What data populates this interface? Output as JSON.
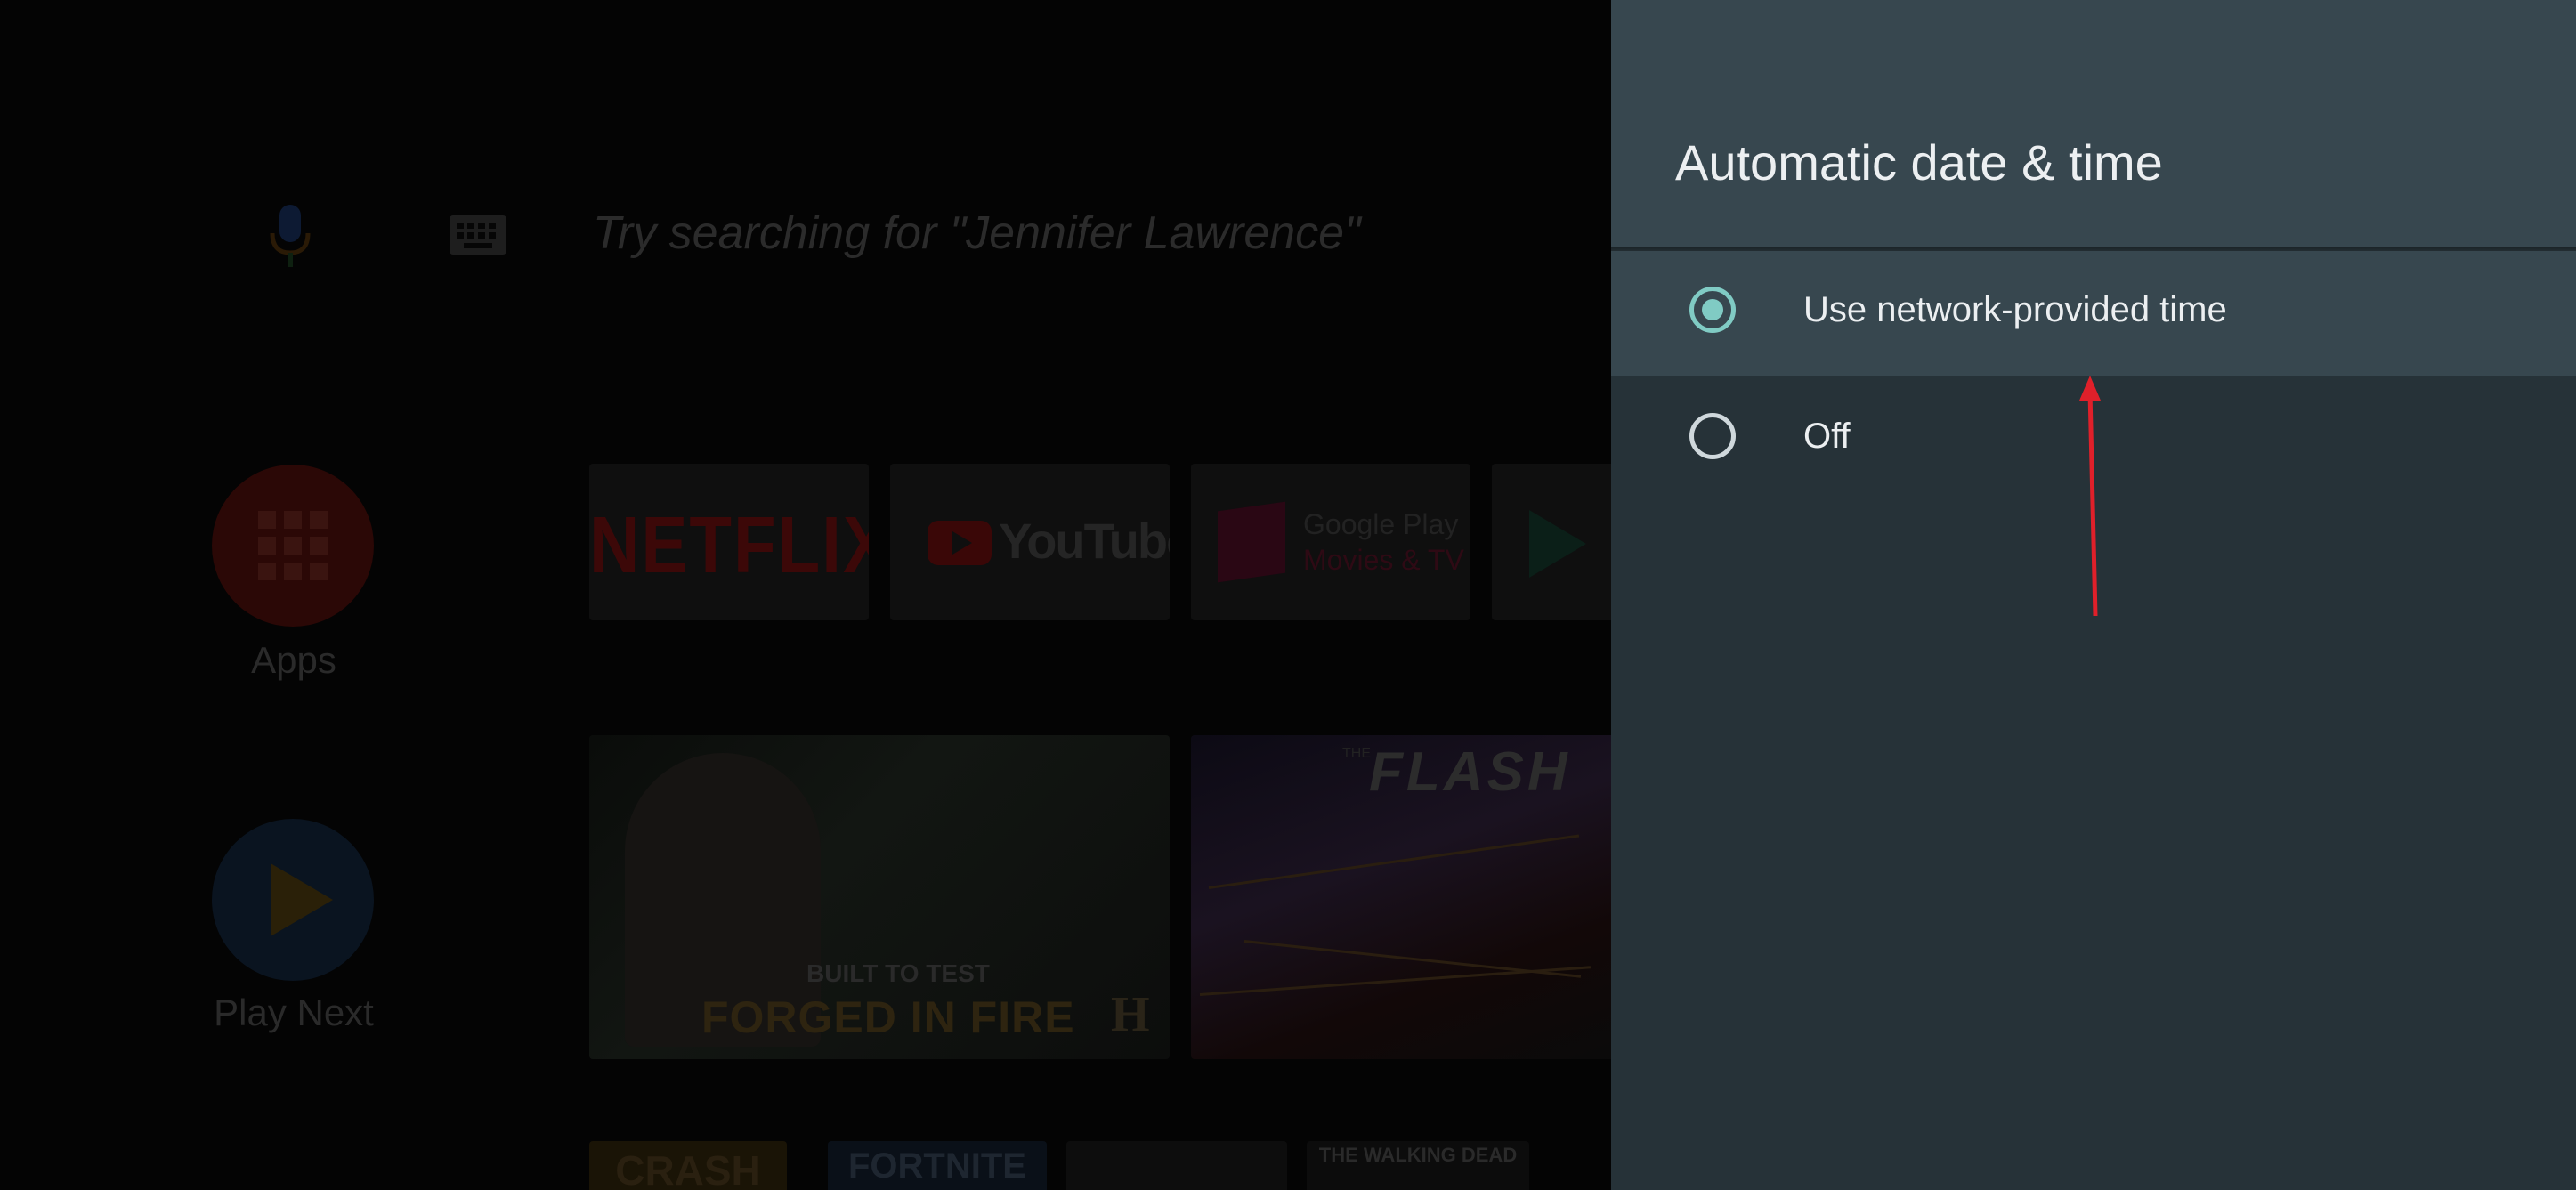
{
  "search": {
    "hint": "Try searching for \"Jennifer Lawrence\""
  },
  "sidebar": {
    "apps_label": "Apps",
    "play_next_label": "Play Next"
  },
  "app_tiles": {
    "netflix": "NETFLIX",
    "youtube": "YouTube",
    "google_play_line1": "Google Play",
    "google_play_line2": "Movies & TV"
  },
  "content_cards": {
    "forged_subtitle": "BUILT TO TEST",
    "forged_title": "FORGED IN FIRE",
    "forged_network": "H",
    "flash_the": "THE",
    "flash_title": "FLASH"
  },
  "bottom_row": {
    "crash": "CRASH",
    "fortnite": "FORTNITE",
    "walking_dead": "THE WALKING DEAD"
  },
  "panel": {
    "title": "Automatic date & time",
    "options": [
      {
        "label": "Use network-provided time",
        "selected": true
      },
      {
        "label": "Off",
        "selected": false
      }
    ]
  },
  "colors": {
    "panel_bg": "#263238",
    "panel_header_bg": "#37474f",
    "radio_accent": "#80cbc4",
    "annotation_arrow": "#e0202a"
  },
  "icons": {
    "mic": "mic-icon",
    "keyboard": "keyboard-icon",
    "apps": "grid-icon",
    "play_next": "play-icon"
  }
}
